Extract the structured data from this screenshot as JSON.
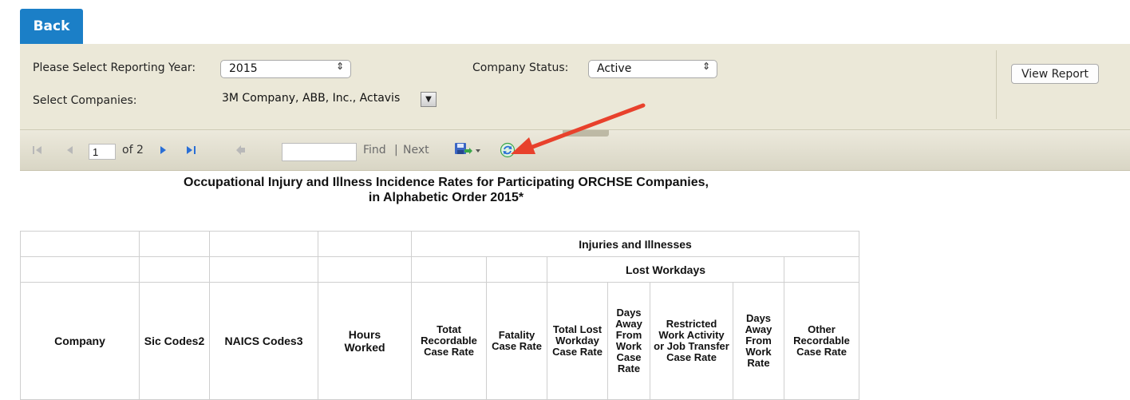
{
  "back_label": "Back",
  "params": {
    "year_label": "Please Select Reporting Year:",
    "year_value": "2015",
    "status_label": "Company Status:",
    "status_value": "Active",
    "companies_label": "Select Companies:",
    "companies_value": "3M Company, ABB, Inc., Actavis",
    "view_report_label": "View Report"
  },
  "toolbar": {
    "page_value": "1",
    "of_pages": "of 2",
    "find_label": "Find",
    "separator": "|",
    "next_label": "Next"
  },
  "report": {
    "title_line1": "Occupational Injury and Illness Incidence Rates for Participating ORCHSE Companies,",
    "title_line2": "in Alphabetic Order  2015*",
    "group_header": "Injuries and Illnesses",
    "subgroup_header": "Lost Workdays",
    "columns": {
      "company": "Company",
      "sic": "Sic Codes2",
      "naics": "NAICS Codes3",
      "hours": "Hours Worked",
      "total_recordable": "Totat Recordable Case Rate",
      "fatality": "Fatality Case Rate",
      "total_lost": "Total Lost Workday Case Rate",
      "days_away": "Days Away From Work Case Rate",
      "restricted": "Restricted Work Activity or Job Transfer Case Rate",
      "days_away_rate": "Days Away From Work Rate",
      "other": "Other Recordable Case Rate"
    }
  },
  "colors": {
    "back_button": "#1b7fc7",
    "param_panel": "#ebe8d8",
    "toolbar_icon_blue": "#2a6fd6",
    "annotation_arrow": "#e8412c"
  }
}
